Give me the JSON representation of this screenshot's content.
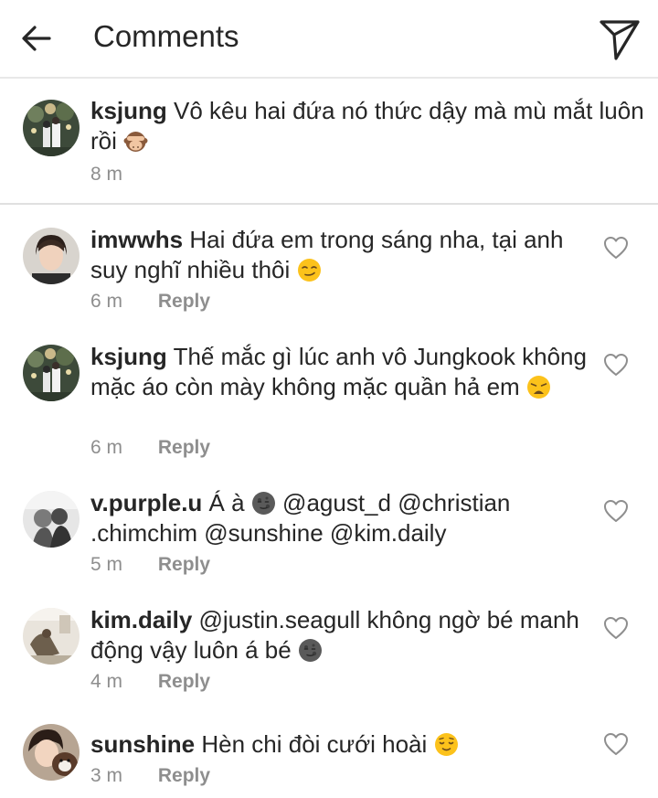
{
  "header": {
    "title": "Comments",
    "back_icon": "arrow-left-icon",
    "share_icon": "paper-plane-icon"
  },
  "caption": {
    "username": "ksjung",
    "text": "Vô kêu hai đứa nó thức dậy mà mù mắt luôn rồi",
    "emoji": "see-no-evil-monkey",
    "time": "8 m"
  },
  "comments": [
    {
      "username": "imwwhs",
      "text": "Hai đứa em trong sáng nha, tại anh suy nghĩ nhiều thôi",
      "emoji": "smirking-face",
      "time": "6 m",
      "reply": "Reply"
    },
    {
      "username": "ksjung",
      "text": "Thế mắc gì lúc anh vô Jungkook không mặc áo còn mày không mặc quần hả em",
      "emoji": "weary-face",
      "time": "6 m",
      "reply": "Reply"
    },
    {
      "username": "v.purple.u",
      "text_before": "Á à",
      "emoji": "new-moon-face",
      "text_after": "@agust_d @christian .chimchim @sunshine @kim.daily",
      "time": "5 m",
      "reply": "Reply"
    },
    {
      "username": "kim.daily",
      "text": "@justin.seagull không ngờ bé manh động vậy luôn á bé",
      "emoji": "new-moon-face",
      "time": "4 m",
      "reply": "Reply"
    },
    {
      "username": "sunshine",
      "text": "Hèn chi đòi cưới hoài",
      "emoji": "relieved-face",
      "time": "3 m",
      "reply": "Reply"
    }
  ],
  "colors": {
    "text": "#262626",
    "secondary": "#8e8e8e",
    "divider": "#e0e0e0"
  }
}
